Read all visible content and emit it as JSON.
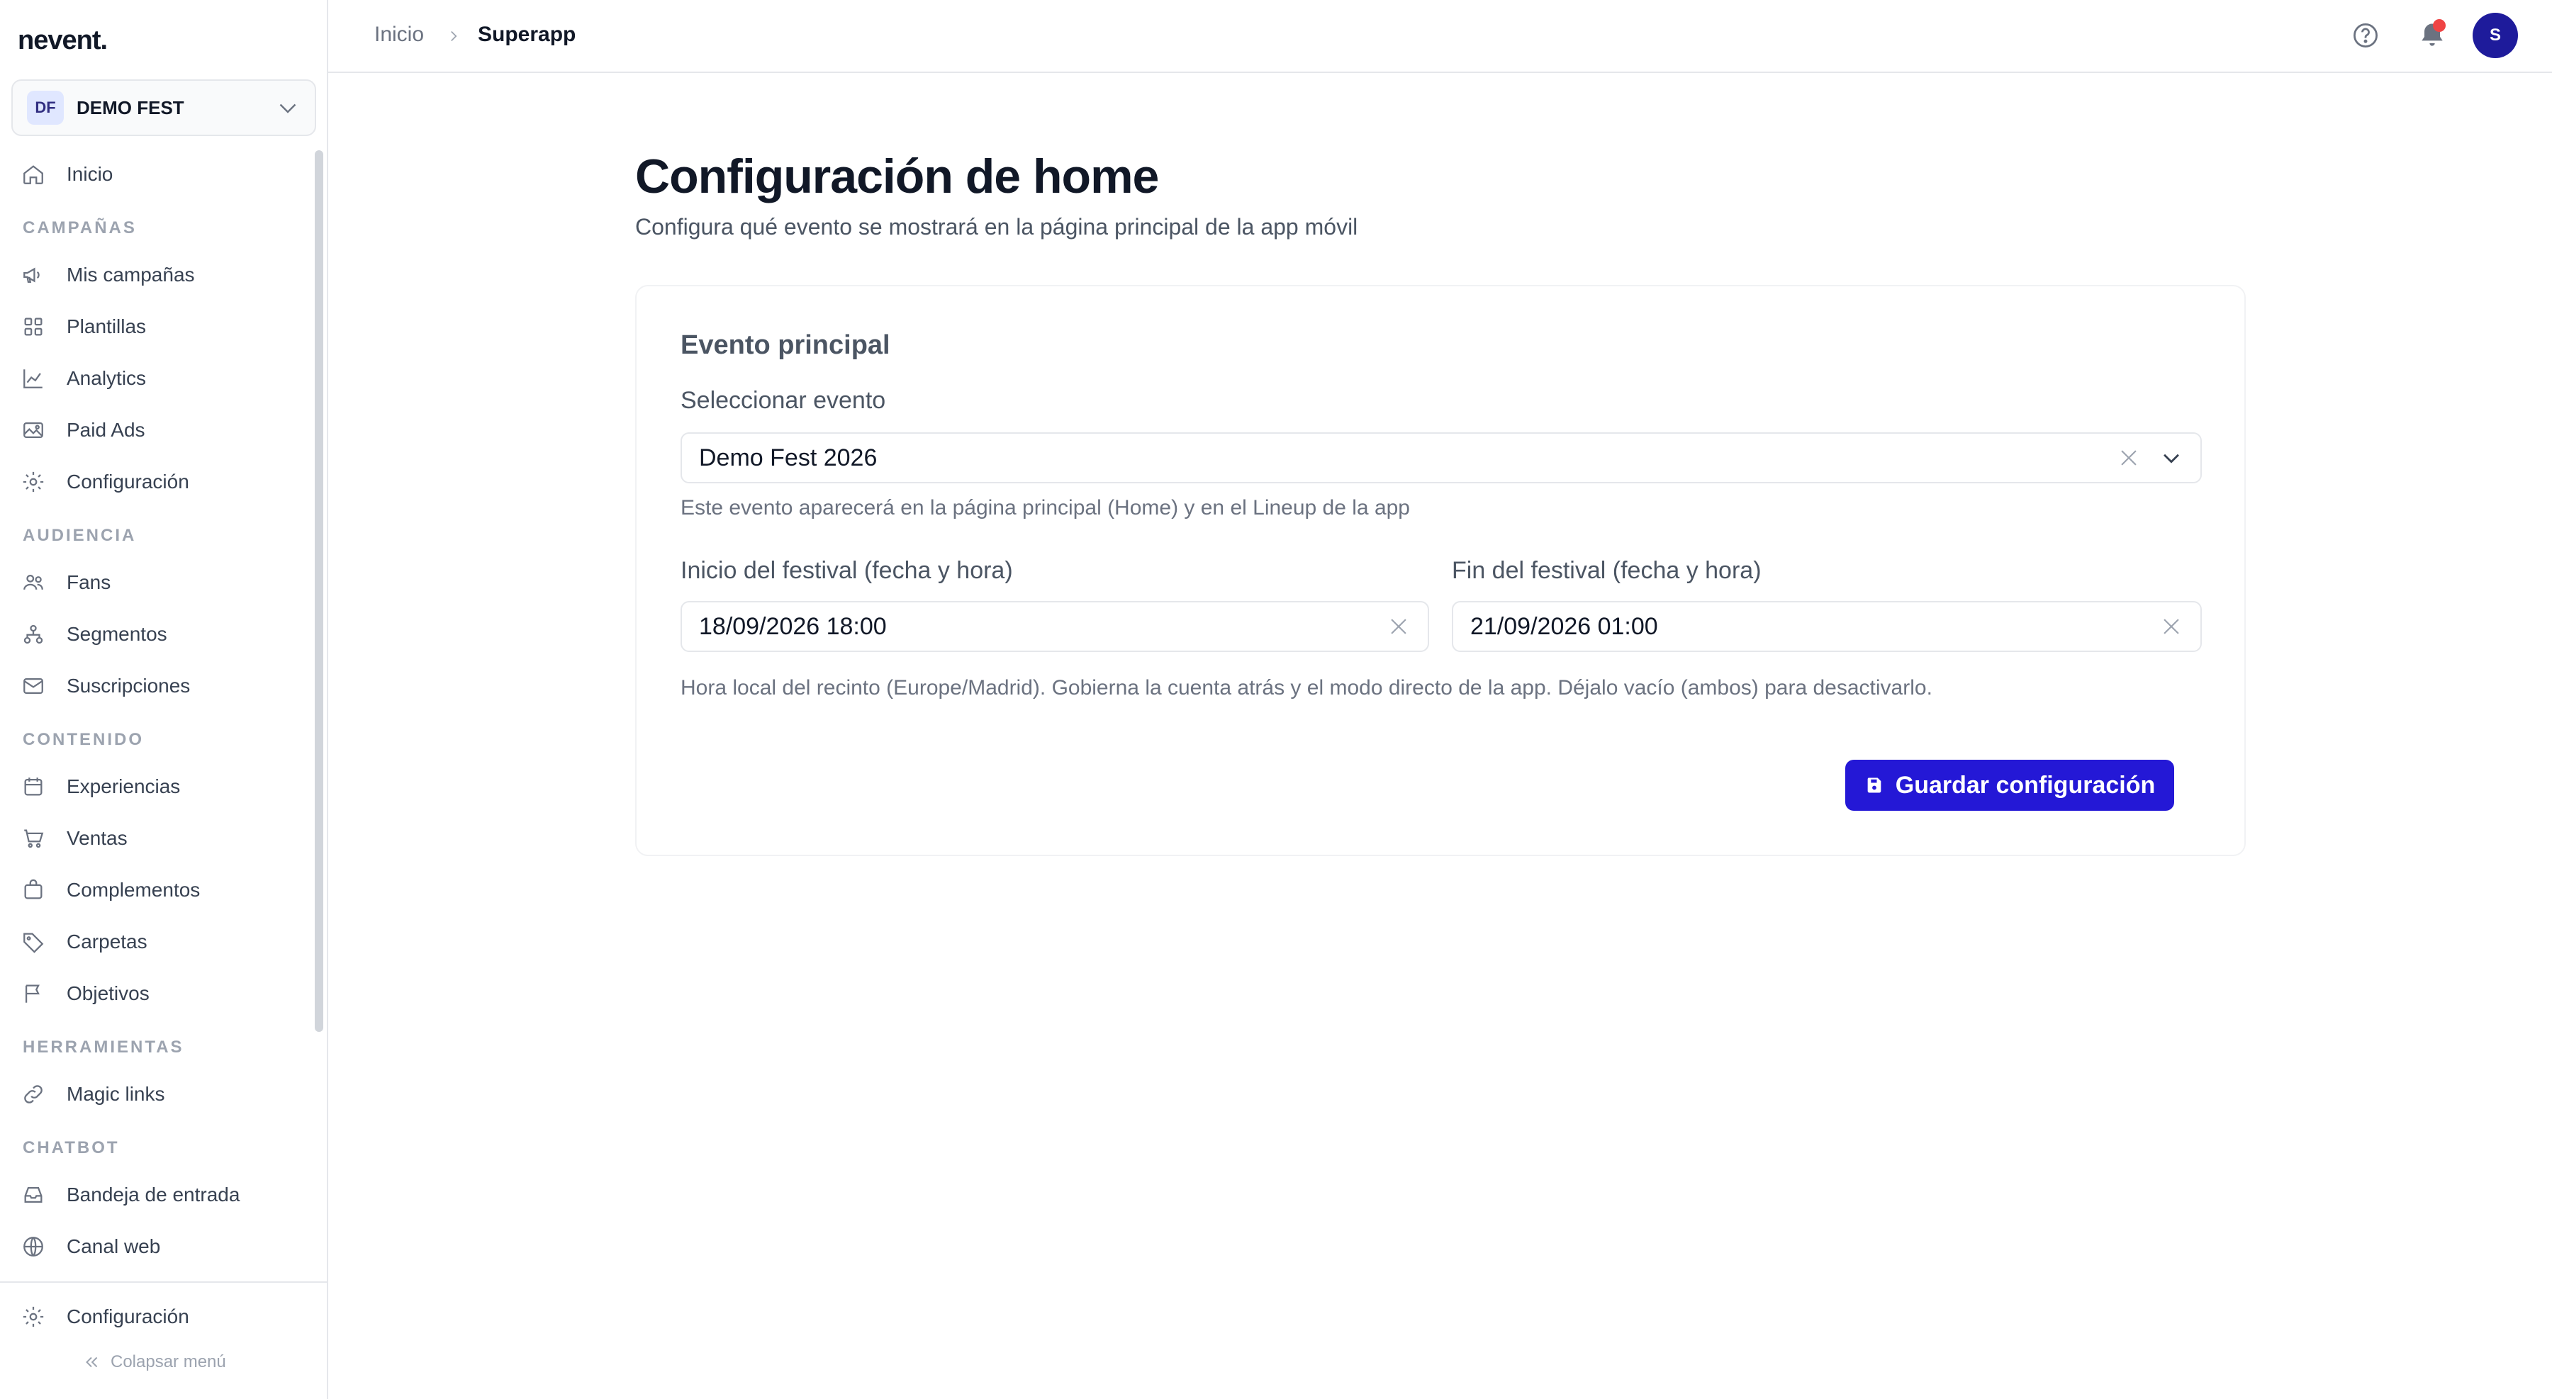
{
  "brand": {
    "logo": "nevent.",
    "accent": "#2418d6"
  },
  "org": {
    "badge": "DF",
    "name": "DEMO FEST"
  },
  "sidebar": {
    "home": "Inicio",
    "sections": {
      "campaigns": "CAMPAÑAS",
      "audience": "AUDIENCIA",
      "content": "CONTENIDO",
      "tools": "HERRAMIENTAS",
      "chatbot": "CHATBOT"
    },
    "items": {
      "my_campaigns": "Mis campañas",
      "templates": "Plantillas",
      "analytics": "Analytics",
      "paid_ads": "Paid Ads",
      "campaign_config": "Configuración",
      "fans": "Fans",
      "segments": "Segmentos",
      "subscriptions": "Suscripciones",
      "experiences": "Experiencias",
      "sales": "Ventas",
      "addons": "Complementos",
      "folders": "Carpetas",
      "goals": "Objetivos",
      "magic_links": "Magic links",
      "inbox": "Bandeja de entrada",
      "web_channel": "Canal web"
    },
    "settings": "Configuración",
    "collapse": "Colapsar menú"
  },
  "header": {
    "breadcrumb": [
      "Inicio",
      "Superapp"
    ],
    "avatar_initial": "S"
  },
  "page": {
    "title": "Configuración de home",
    "subtitle": "Configura qué evento se mostrará en la página principal de la app móvil"
  },
  "card": {
    "title": "Evento principal",
    "event_label": "Seleccionar evento",
    "event_value": "Demo Fest 2026",
    "event_help": "Este evento aparecerá en la página principal (Home) y en el Lineup de la app",
    "start_label": "Inicio del festival (fecha y hora)",
    "start_value": "18/09/2026 18:00",
    "end_label": "Fin del festival (fecha y hora)",
    "end_value": "21/09/2026 01:00",
    "dates_help": "Hora local del recinto (Europe/Madrid). Gobierna la cuenta atrás y el modo directo de la app. Déjalo vacío (ambos) para desactivarlo.",
    "save_label": "Guardar configuración"
  }
}
